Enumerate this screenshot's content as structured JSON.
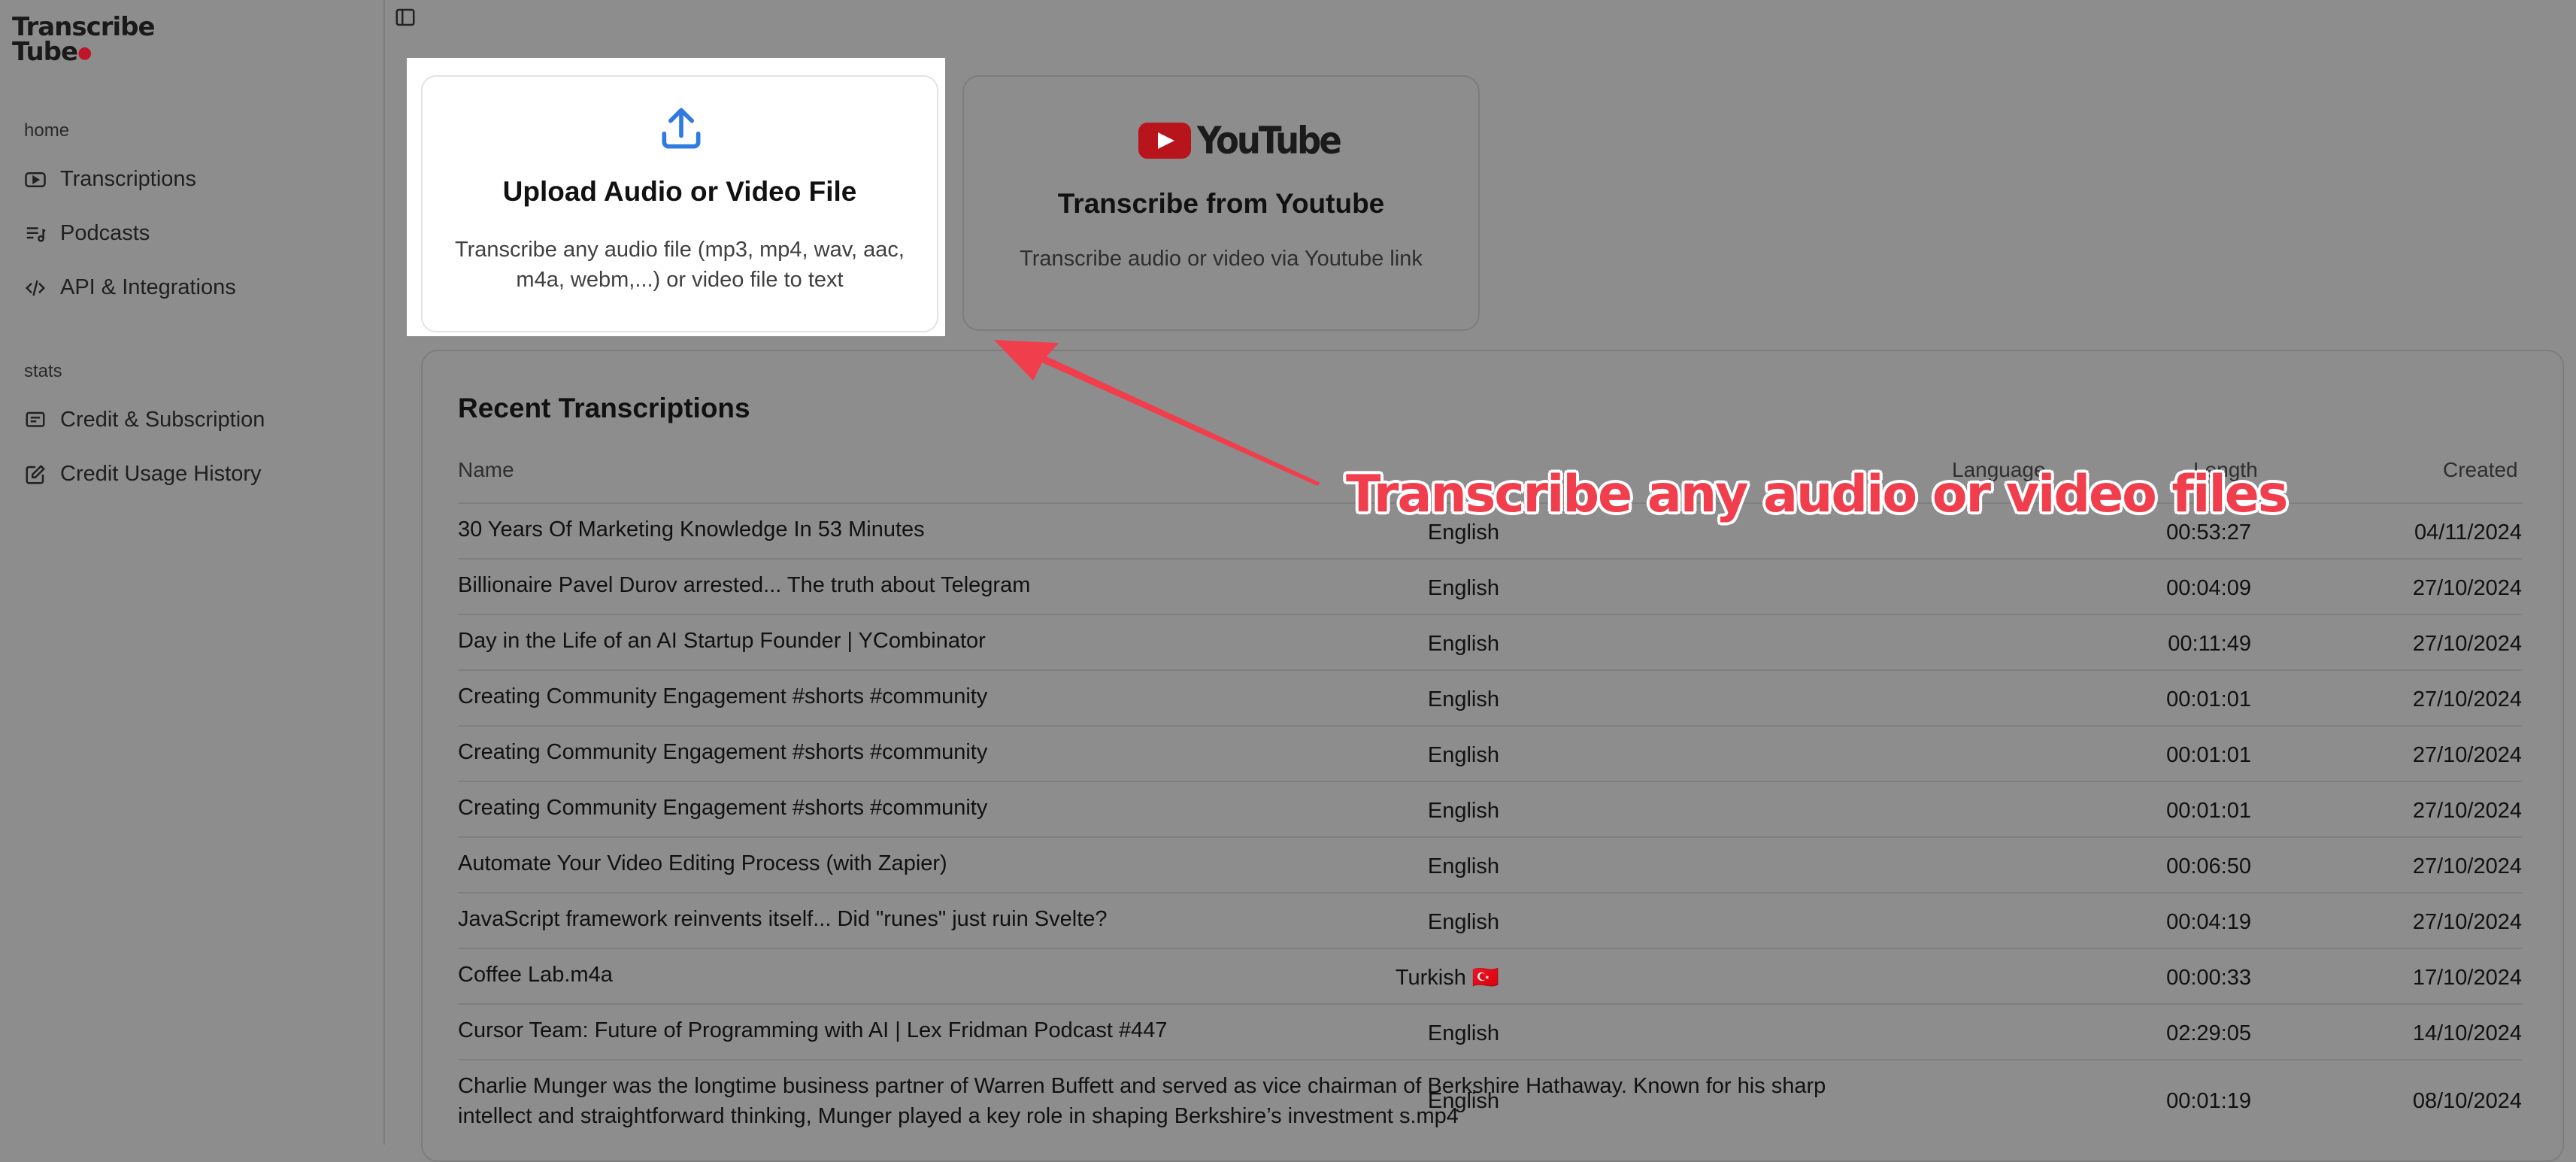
{
  "app": {
    "logo_line1": "Transcribe",
    "logo_line2": "Tube"
  },
  "sidebar": {
    "section_home": "home",
    "section_stats": "stats",
    "items": [
      {
        "label": "Transcriptions",
        "icon": "youtube-play-icon"
      },
      {
        "label": "Podcasts",
        "icon": "podcast-list-icon"
      },
      {
        "label": "API & Integrations",
        "icon": "code-icon"
      },
      {
        "label": "Credit & Subscription",
        "icon": "card-icon"
      },
      {
        "label": "Credit Usage History",
        "icon": "edit-square-icon"
      }
    ]
  },
  "upload_card": {
    "title": "Upload Audio or Video File",
    "desc": "Transcribe any audio file (mp3, mp4, wav, aac, m4a, webm,...) or video file to text",
    "icon": "upload-icon"
  },
  "youtube_card": {
    "logo_text": "YouTube",
    "title": "Transcribe from Youtube",
    "desc": "Transcribe audio or video via Youtube link"
  },
  "recent": {
    "title": "Recent Transcriptions",
    "columns": {
      "name": "Name",
      "language": "Language",
      "length": "Length",
      "created": "Created"
    },
    "rows": [
      {
        "name": "30 Years Of Marketing Knowledge In 53 Minutes",
        "language": "English",
        "length": "00:53:27",
        "created": "04/11/2024"
      },
      {
        "name": "Billionaire Pavel Durov arrested... The truth about Telegram",
        "language": "English",
        "length": "00:04:09",
        "created": "27/10/2024"
      },
      {
        "name": "Day in the Life of an AI Startup Founder | YCombinator",
        "language": "English",
        "length": "00:11:49",
        "created": "27/10/2024"
      },
      {
        "name": "Creating Community Engagement #shorts #community",
        "language": "English",
        "length": "00:01:01",
        "created": "27/10/2024"
      },
      {
        "name": "Creating Community Engagement #shorts #community",
        "language": "English",
        "length": "00:01:01",
        "created": "27/10/2024"
      },
      {
        "name": "Creating Community Engagement #shorts #community",
        "language": "English",
        "length": "00:01:01",
        "created": "27/10/2024"
      },
      {
        "name": "Automate Your Video Editing Process (with Zapier)",
        "language": "English",
        "length": "00:06:50",
        "created": "27/10/2024"
      },
      {
        "name": "JavaScript framework reinvents itself... Did \"runes\" just ruin Svelte?",
        "language": "English",
        "length": "00:04:19",
        "created": "27/10/2024"
      },
      {
        "name": "Coffee Lab.m4a",
        "language": "Turkish 🇹🇷",
        "length": "00:00:33",
        "created": "17/10/2024"
      },
      {
        "name": "Cursor Team: Future of Programming with AI | Lex Fridman Podcast #447",
        "language": "English",
        "length": "02:29:05",
        "created": "14/10/2024"
      },
      {
        "name": "Charlie Munger was the longtime business partner of Warren Buffett and served as vice chairman of Berkshire Hathaway. Known for his sharp intellect and straightforward thinking, Munger played a key role in shaping Berkshire’s investment s.mp4",
        "language": "English",
        "length": "00:01:19",
        "created": "08/10/2024"
      }
    ]
  },
  "annotation": {
    "text": "Transcribe any audio or video files",
    "color": "#f03e4d"
  }
}
